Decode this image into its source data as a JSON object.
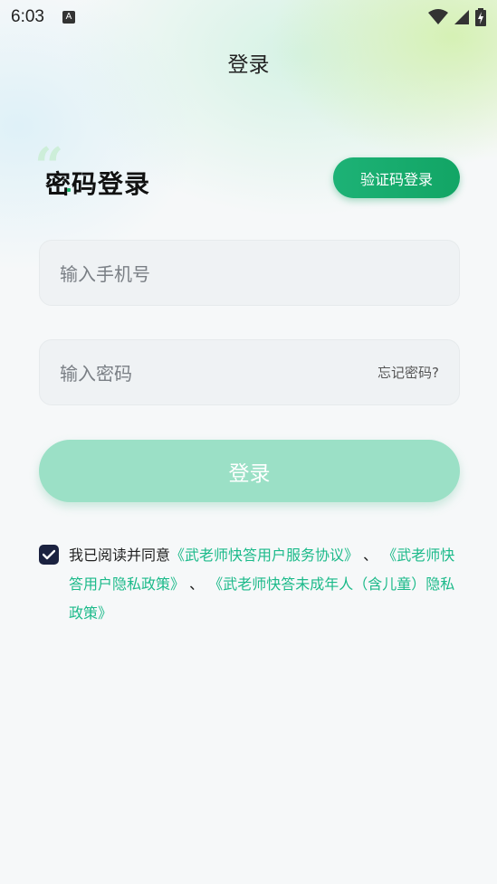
{
  "status_bar": {
    "time": "6:03",
    "notification_glyph": "A"
  },
  "header": {
    "title": "登录"
  },
  "login": {
    "heading": "密码登录",
    "switch_button": "验证码登录",
    "phone_placeholder": "输入手机号",
    "password_placeholder": "输入密码",
    "forgot_password": "忘记密码?",
    "submit": "登录"
  },
  "agreement": {
    "checked": true,
    "prefix": "我已阅读并同意",
    "link_service": "《武老师快答用户服务协议》",
    "sep1": " 、 ",
    "link_privacy": "《武老师快答用户隐私政策》",
    "sep2": " 、 ",
    "link_minor": "《武老师快答未成年人（含儿童）隐私政策》"
  },
  "colors": {
    "accent": "#12a565",
    "submit_disabled": "#9be0c6",
    "link": "#1cba8a",
    "checkbox": "#1b2240"
  }
}
